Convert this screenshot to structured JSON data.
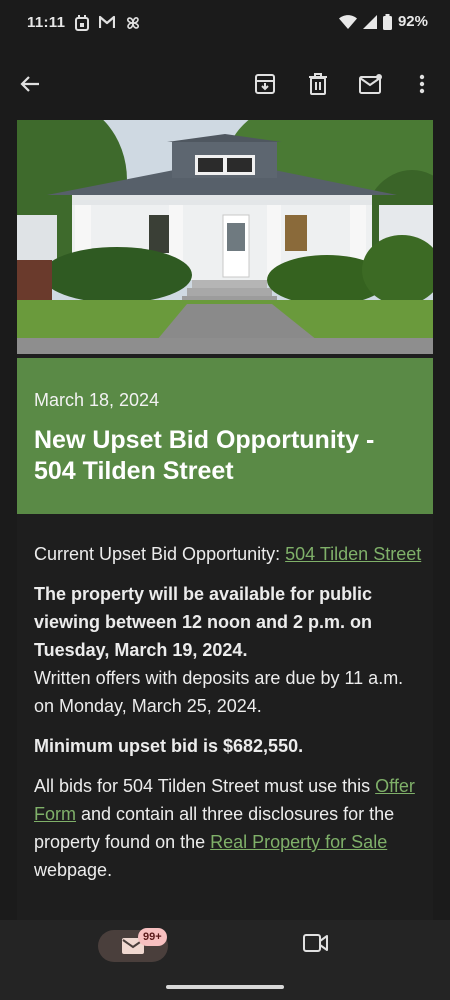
{
  "status_bar": {
    "time": "11:11",
    "battery": "92%",
    "left_icons": [
      "calendar-icon",
      "gmail-icon",
      "pinwheel-icon"
    ],
    "right_icons": [
      "wifi-icon",
      "signal-icon",
      "battery-icon"
    ]
  },
  "toolbar": {
    "icons": [
      "back-arrow-icon",
      "archive-icon",
      "delete-icon",
      "mark-unread-icon",
      "more-vert-icon"
    ]
  },
  "email": {
    "banner_date": "March 18, 2024",
    "banner_title": "New Upset Bid Opportunity - 504 Tilden Street",
    "p1_prefix": "Current Upset Bid Opportunity: ",
    "p1_link": "504 Tilden Street",
    "p2_bold": "The property will be available for public viewing between 12 noon and 2 p.m. on Tuesday, March 19, 2024.",
    "p2_rest": "Written offers with deposits are due by 11 a.m. on Monday, March 25, 2024.",
    "p3_bold": "Minimum upset bid is $682,550.",
    "p4_prefix": "All bids for 504 Tilden Street must use this ",
    "p4_link1": "Offer Form",
    "p4_middle": " and contain all three disclosures for the property found on the ",
    "p4_link2": "Real Property for Sale",
    "p4_suffix": " webpage."
  },
  "bottom_nav": {
    "mail_badge": "99+",
    "items": [
      "mail-icon",
      "meet-video-icon"
    ]
  },
  "colors": {
    "background": "#1b1b1b",
    "banner_green": "#5a8a46",
    "link_green": "#7fb069"
  }
}
